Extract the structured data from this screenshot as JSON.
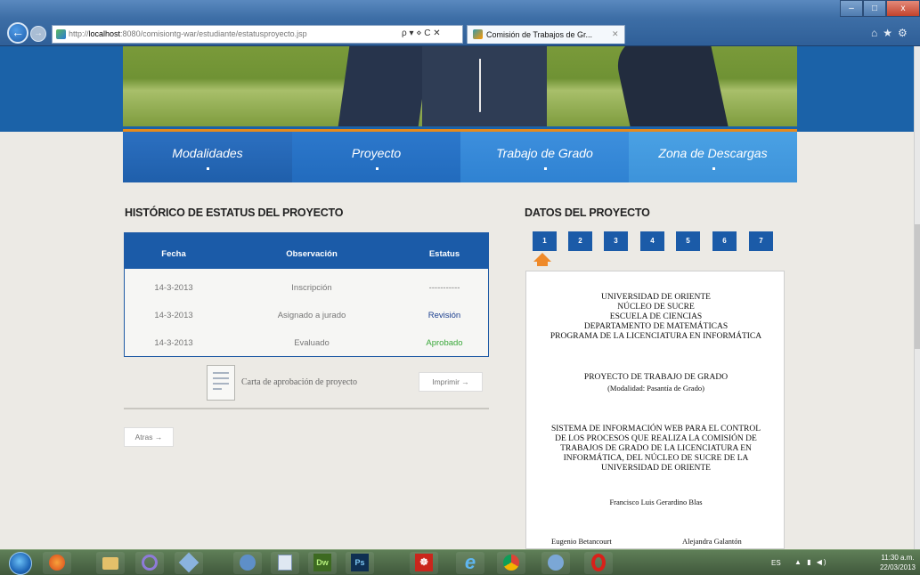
{
  "browser": {
    "url_prefix": "http://",
    "url_host": "localhost",
    "url_path": ":8080/comisiontg-war/estudiante/estatusproyecto.jsp",
    "url_controls": "ρ ▾ ⋄ C ✕",
    "tab_title": "Comisión de Trabajos de Gr...",
    "tab_close": "✕",
    "back_icon": "back-arrow-icon",
    "forward_icon": "forward-arrow-icon",
    "window_min": "–",
    "window_max": "□",
    "window_close": "x",
    "tools": "⌂★⚙"
  },
  "nav": {
    "items": [
      {
        "label": "Modalidades"
      },
      {
        "label": "Proyecto"
      },
      {
        "label": "Trabajo de Grado"
      },
      {
        "label": "Zona de Descargas"
      }
    ]
  },
  "history": {
    "title": "HISTÓRICO DE ESTATUS DEL PROYECTO",
    "columns": [
      "Fecha",
      "Observación",
      "Estatus"
    ],
    "rows": [
      {
        "fecha": "14-3-2013",
        "observacion": "Inscripción",
        "estatus": "-----------",
        "color": "#777777"
      },
      {
        "fecha": "14-3-2013",
        "observacion": "Asignado a jurado",
        "estatus": "Revisión",
        "color": "#1b3f8f"
      },
      {
        "fecha": "14-3-2013",
        "observacion": "Evaluado",
        "estatus": "Aprobado",
        "color": "#3aa83a"
      }
    ],
    "carta_label": "Carta de aprobación de proyecto",
    "print_button": "Imprimir  →",
    "back_button": "Atras  →"
  },
  "datos": {
    "title": "DATOS DEL PROYECTO",
    "pages": [
      "1",
      "2",
      "3",
      "4",
      "5",
      "6",
      "7"
    ],
    "selected_page": "1",
    "doc": {
      "univ": "UNIVERSIDAD DE ORIENTE",
      "nucleo": "NÚCLEO DE SUCRE",
      "escuela": "ESCUELA DE CIENCIAS",
      "depto": "DEPARTAMENTO DE MATEMÁTICAS",
      "programa": "PROGRAMA DE LA LICENCIATURA EN INFORMÁTICA",
      "proyecto": "PROYECTO DE TRABAJO DE GRADO",
      "modalidad": "(Modalidad: Pasantía de Grado)",
      "titulo_1": "SISTEMA DE INFORMACIÓN WEB PARA EL CONTROL",
      "titulo_2": "DE LOS PROCESOS QUE REALIZA LA COMISIÓN DE",
      "titulo_3": "TRABAJOS DE GRADO DE LA LICENCIATURA EN",
      "titulo_4": "INFORMÁTICA, DEL NÚCLEO DE SUCRE DE LA",
      "titulo_5": "UNIVERSIDAD DE ORIENTE",
      "autor": "Francisco Luis Gerardino Blas",
      "asesor_1": "Eugenio Betancourt",
      "asesor_2": "Alejandra Galantón"
    }
  },
  "taskbar": {
    "apps": [
      "start-orb",
      "firefox",
      "explorer",
      "eclipse",
      "virtualbox",
      "pgadmin",
      "notepad",
      "dreamweaver",
      "photoshop",
      "acrobat",
      "internet-explorer",
      "chrome",
      "itunes",
      "opera"
    ],
    "labels": {
      "dreamweaver": "Dw",
      "photoshop": "Ps",
      "acrobat": "☸",
      "internet-explorer": "e"
    },
    "language": "ES",
    "tray_icons": "▲  ▮  ◀)",
    "time": "11:30 a.m.",
    "date": "22/03/2013"
  }
}
